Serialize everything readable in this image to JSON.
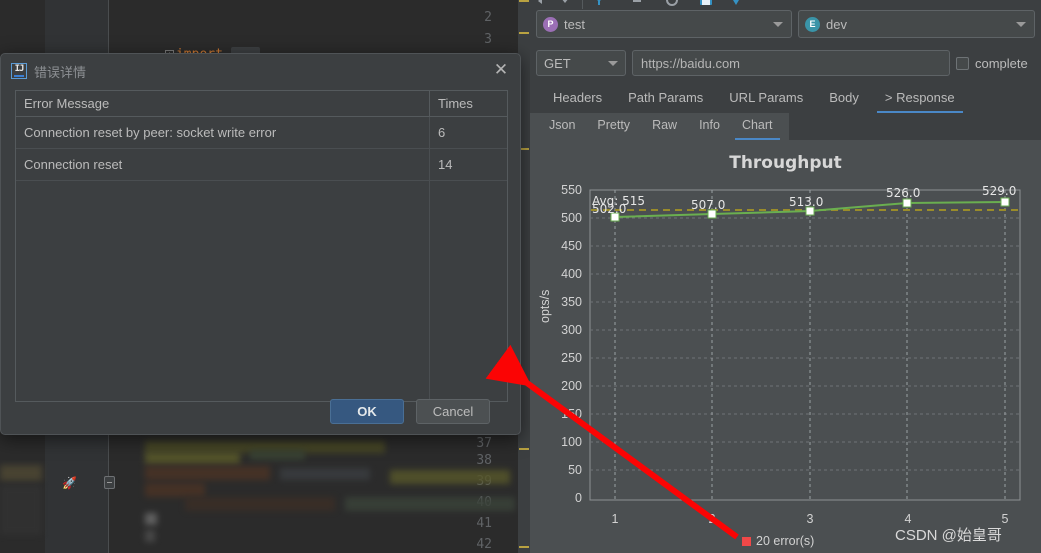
{
  "ide": {
    "line_numbers": [
      "2",
      "3",
      "37",
      "38",
      "39",
      "40",
      "41",
      "42"
    ],
    "code_line_3": "import",
    "code_ellipsis": "...",
    "rocket_icon": "rocket-icon",
    "gutter_marker_color": "#b9a241"
  },
  "dialog": {
    "title": "错误详情",
    "app_icon": "IJ",
    "close_icon": "✕",
    "table": {
      "columns": [
        "Error Message",
        "Times"
      ],
      "rows": [
        {
          "message": "Connection reset by peer: socket write error",
          "times": "6"
        },
        {
          "message": "Connection reset",
          "times": "14"
        }
      ]
    },
    "buttons": {
      "ok": "OK",
      "cancel": "Cancel"
    }
  },
  "right_panel": {
    "project_combo": {
      "badge": "P",
      "badge_color": "#9b6fb5",
      "label": "test"
    },
    "env_combo": {
      "badge": "E",
      "badge_color": "#3a94a8",
      "label": "dev"
    },
    "method": "GET",
    "url": "https://baidu.com",
    "url_placeholder": "https://",
    "complete_checkbox": {
      "label": "complete",
      "checked": false
    },
    "main_tabs": [
      {
        "label": "Headers",
        "active": false
      },
      {
        "label": "Path Params",
        "active": false
      },
      {
        "label": "URL Params",
        "active": false
      },
      {
        "label": "Body",
        "active": false
      },
      {
        "label": "> Response",
        "active": true
      }
    ],
    "sub_tabs": [
      {
        "label": "Json",
        "active": false
      },
      {
        "label": "Pretty",
        "active": false
      },
      {
        "label": "Raw",
        "active": false
      },
      {
        "label": "Info",
        "active": false
      },
      {
        "label": "Chart",
        "active": true
      }
    ]
  },
  "chart_data": {
    "type": "line",
    "title": "Throughput",
    "xlabel": "",
    "ylabel": "opts/s",
    "x": [
      1,
      2,
      3,
      4,
      5
    ],
    "xtick_labels": [
      "1",
      "2",
      "3",
      "4",
      "5"
    ],
    "ytick_labels": [
      "0",
      "50",
      "100",
      "150",
      "200",
      "250",
      "300",
      "350",
      "400",
      "450",
      "500",
      "550"
    ],
    "ylim": [
      0,
      550
    ],
    "ytick_step": 50,
    "grid": true,
    "series": [
      {
        "name": "Throughput",
        "color": "#6aaf50",
        "marker": "square",
        "marker_color": "#ffffff",
        "values": [
          502.0,
          507.0,
          513.0,
          526.0,
          529.0
        ],
        "point_labels": [
          "502.0",
          "507.0",
          "513.0",
          "526.0",
          "529.0"
        ]
      }
    ],
    "average_line": {
      "label": "Avg: 515",
      "value": 515,
      "color": "#9a8c2a",
      "style": "dashed"
    },
    "legend": {
      "position": "bottom",
      "entries": [
        {
          "label": "20 error(s)",
          "color": "#f04848"
        }
      ]
    },
    "watermark": "CSDN @始皇哥"
  },
  "annotation": {
    "arrow_color": "#fb0404",
    "from": "chart-area",
    "to": "dialog-edge"
  }
}
